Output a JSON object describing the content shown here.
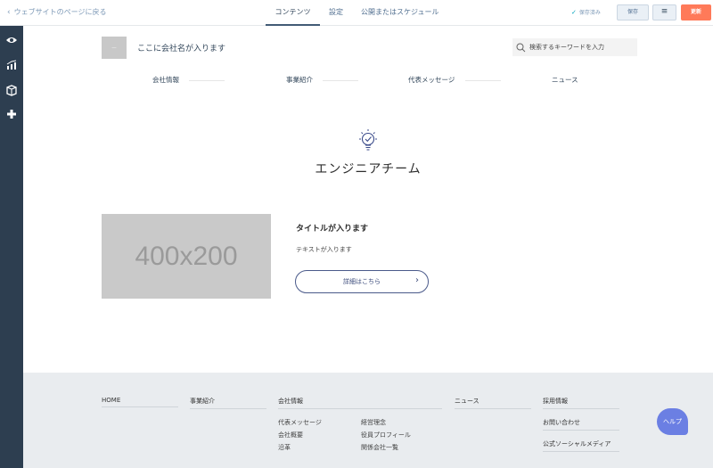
{
  "topbar": {
    "back_label": "ウェブサイトのページに戻る",
    "tabs": [
      {
        "label": "コンテンツ"
      },
      {
        "label": "設定"
      },
      {
        "label": "公開またはスケジュール"
      }
    ],
    "saved_label": "保存済み",
    "save_label": "保存",
    "menu_icon": "≡",
    "update_label": "更新"
  },
  "rail": {
    "icons": [
      "eye-icon",
      "chart-icon",
      "box-icon",
      "plus-icon"
    ]
  },
  "site": {
    "logo_text": "ー",
    "company_name": "ここに会社名が入ります",
    "search_placeholder": "検索するキーワードを入力",
    "nav": [
      "会社情報",
      "事業紹介",
      "代表メッセージ",
      "ニュース"
    ],
    "heading": "エンジニアチーム",
    "card": {
      "image_text": "400x200",
      "title": "タイトルが入ります",
      "text": "テキストが入ります",
      "button_label": "詳細はこちら"
    }
  },
  "footer": {
    "home": "HOME",
    "business": "事業紹介",
    "company": "会社情報",
    "news": "ニュース",
    "recruit": "採用情報",
    "company_links_left": [
      "代表メッセージ",
      "会社概要",
      "沿革"
    ],
    "company_links_right": [
      "経営理念",
      "役員プロフィール",
      "関係会社一覧"
    ],
    "contact": "お問い合わせ",
    "social": "公式ソーシャルメディア"
  },
  "help_label": "ヘルプ",
  "colors": {
    "rail": "#2d3e50",
    "update_button": "#ff7a59",
    "help_button": "#6b7fe3",
    "image_placeholder": "#c9c9c9"
  }
}
